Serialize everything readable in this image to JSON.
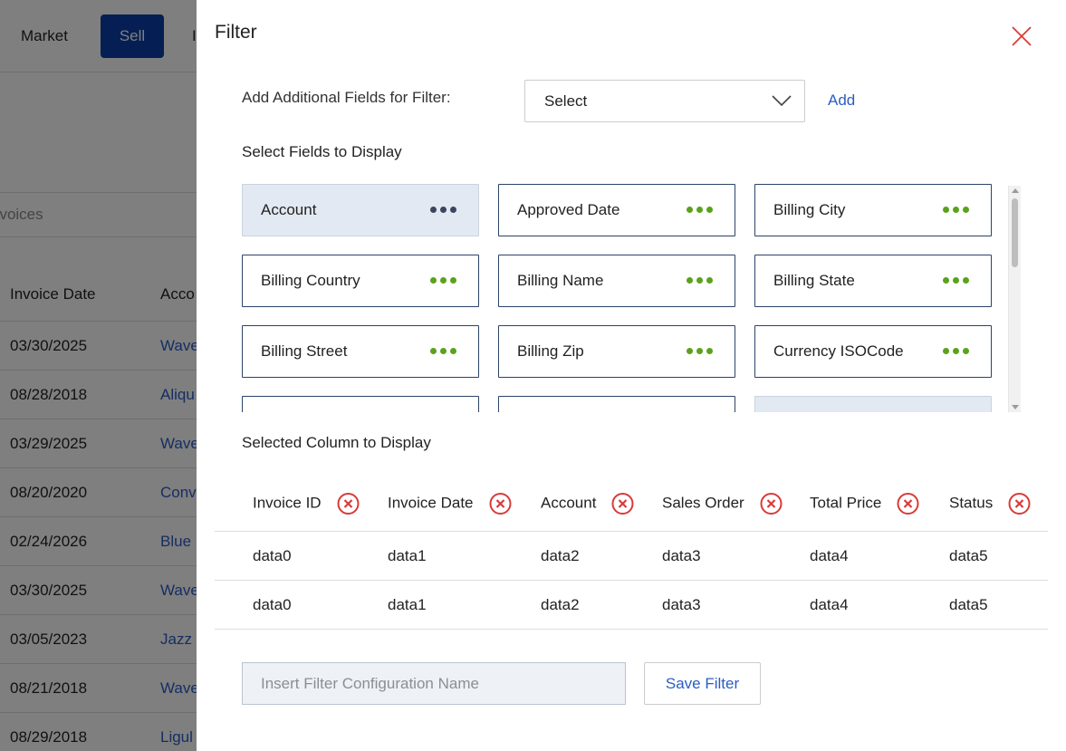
{
  "background": {
    "nav": {
      "market": "Market",
      "sell": "Sell",
      "third": "I"
    },
    "search_text": "nvoices",
    "table": {
      "headers": [
        "Invoice Date",
        "Acco"
      ],
      "rows": [
        [
          "03/30/2025",
          "Wave"
        ],
        [
          "08/28/2018",
          "Aliqu"
        ],
        [
          "03/29/2025",
          "Wave"
        ],
        [
          "08/20/2020",
          "Conv"
        ],
        [
          "02/24/2026",
          "Blue"
        ],
        [
          "03/30/2025",
          "Wave"
        ],
        [
          "03/05/2023",
          "Jazz"
        ],
        [
          "08/21/2018",
          "Wave"
        ],
        [
          "08/29/2018",
          "Ligul"
        ]
      ]
    }
  },
  "drawer": {
    "title": "Filter",
    "add_fields_label": "Add Additional Fields for Filter:",
    "select_value": "Select",
    "add_label": "Add",
    "fields_section_label": "Select Fields to Display",
    "fields": [
      {
        "label": "Account",
        "active": true
      },
      {
        "label": "Approved Date",
        "active": false
      },
      {
        "label": "Billing City",
        "active": false
      },
      {
        "label": "Billing Country",
        "active": false
      },
      {
        "label": "Billing Name",
        "active": false
      },
      {
        "label": "Billing State",
        "active": false
      },
      {
        "label": "Billing Street",
        "active": false
      },
      {
        "label": "Billing Zip",
        "active": false
      },
      {
        "label": "Currency ISOCode",
        "active": false
      },
      {
        "label": "",
        "active": false
      },
      {
        "label": "",
        "active": false
      },
      {
        "label": "",
        "active": false,
        "grey": true
      }
    ],
    "columns_section_label": "Selected Column to Display",
    "columns": [
      "Invoice ID",
      "Invoice Date",
      "Account",
      "Sales Order",
      "Total Price",
      "Status"
    ],
    "rows": [
      [
        "data0",
        "data1",
        "data2",
        "data3",
        "data4",
        "data5"
      ],
      [
        "data0",
        "data1",
        "data2",
        "data3",
        "data4",
        "data5"
      ]
    ],
    "config_placeholder": "Insert Filter Configuration Name",
    "save_label": "Save Filter",
    "colors": {
      "accent": "#2a5cc4",
      "dots": "#5aa21c",
      "remove": "#d93a3a",
      "sell_button": "#0b3ea8"
    }
  }
}
